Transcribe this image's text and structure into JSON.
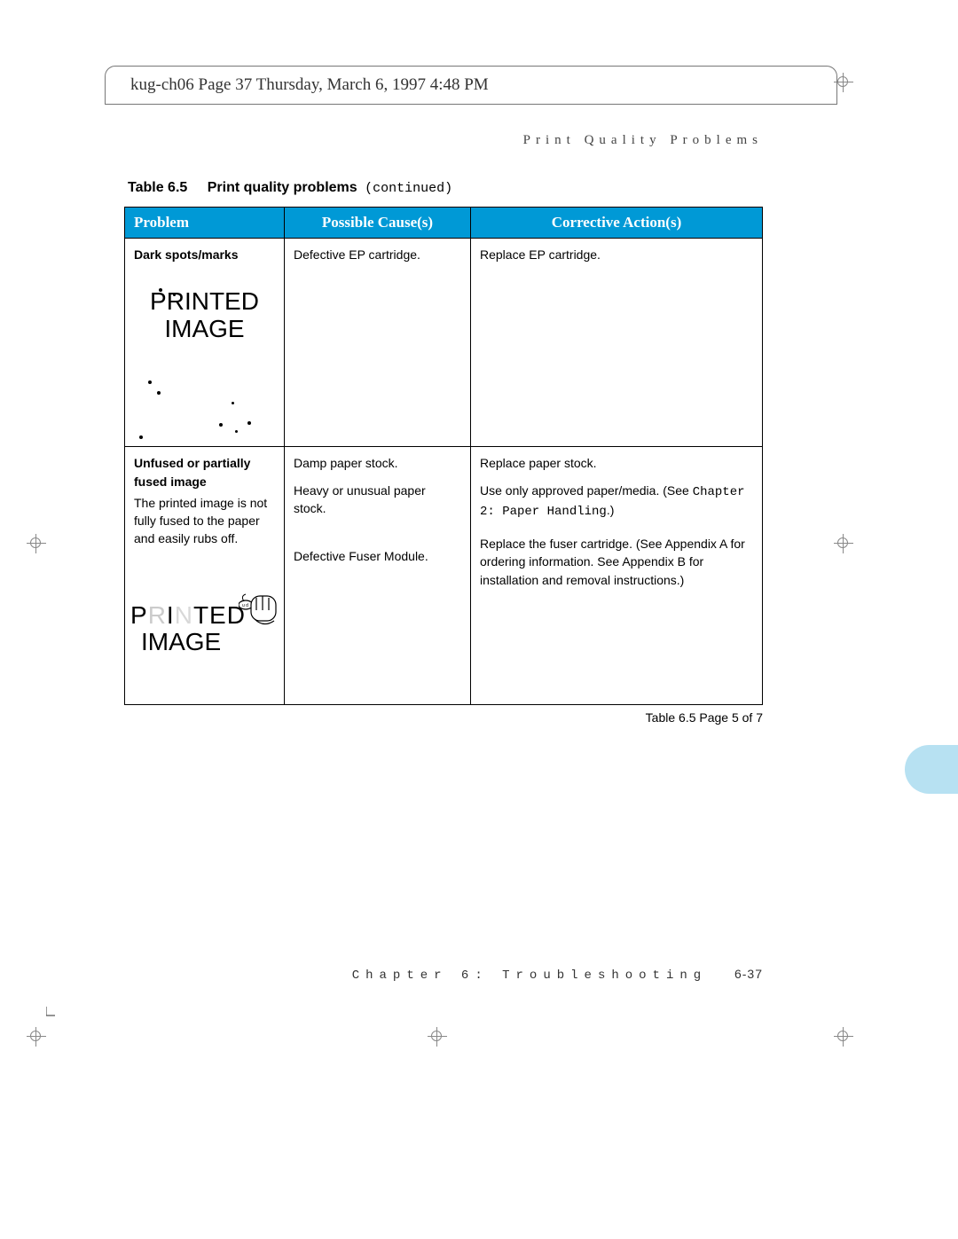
{
  "header": "kug-ch06  Page 37  Thursday, March 6, 1997  4:48 PM",
  "running_head": "Print Quality Problems",
  "caption": {
    "label": "Table 6.5",
    "title": "Print quality problems",
    "cont": "(continued)"
  },
  "columns": [
    "Problem",
    "Possible Cause(s)",
    "Corrective Action(s)"
  ],
  "rows": [
    {
      "problem_title": "Dark spots/marks",
      "problem_img_line1": "PRINTED",
      "problem_img_line2": "IMAGE",
      "cause": "Defective EP cartridge.",
      "action": "Replace EP cartridge."
    },
    {
      "problem_title": "Unfused or partially fused image",
      "problem_desc": "The printed image is not fully fused to the paper and easily rubs off.",
      "problem_img_line1": "PRINTED",
      "problem_img_line2": "IMAGE",
      "causes": [
        "Damp paper stock.",
        "Heavy or unusual paper stock.",
        "Defective Fuser Module."
      ],
      "actions_plain1": "Replace paper stock.",
      "actions_line2a": "Use only approved paper/media. (See ",
      "actions_line2b": "Chapter 2: Paper Handling",
      "actions_line2c": ".)",
      "actions_plain3": "Replace the fuser cartridge. (See Appendix A for ordering information. See Appendix B for installation and removal instructions.)"
    }
  ],
  "table_footer": "Table 6.5  Page 5 of 7",
  "page_footer_a": "Chapter 6: Troubleshooting",
  "page_footer_b": "6-37"
}
